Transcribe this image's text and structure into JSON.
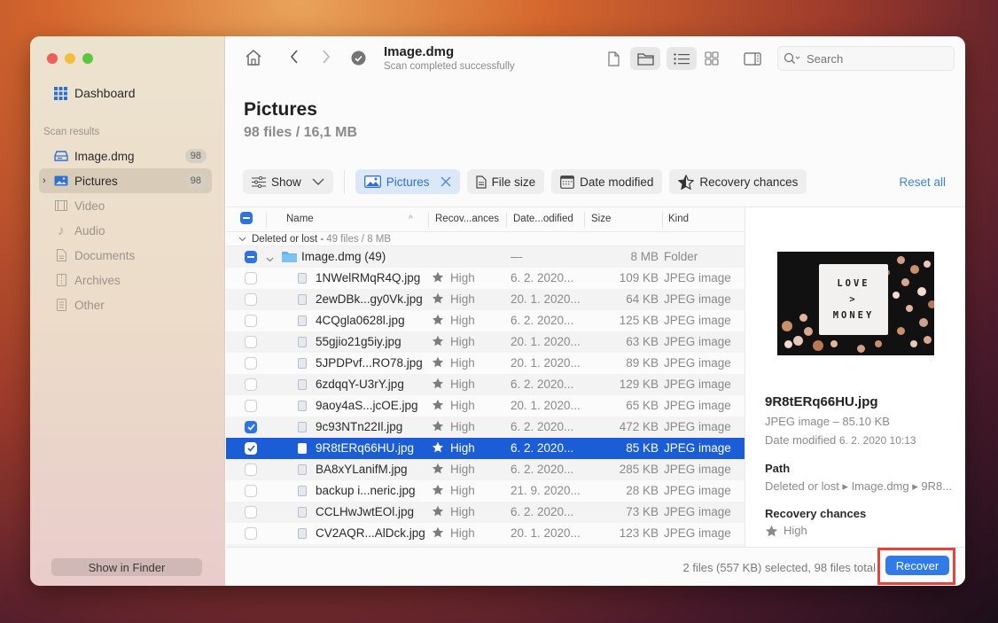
{
  "window": {
    "title": "Image.dmg",
    "subtitle": "Scan completed successfully"
  },
  "sidebar": {
    "dashboard_label": "Dashboard",
    "section_label": "Scan results",
    "items": [
      {
        "label": "Image.dmg",
        "count": "98",
        "icon": "disk-icon",
        "state": "normal"
      },
      {
        "label": "Pictures",
        "count": "98",
        "icon": "picture-icon",
        "state": "active"
      },
      {
        "label": "Video",
        "icon": "film-icon",
        "state": "dim"
      },
      {
        "label": "Audio",
        "icon": "music-note-icon",
        "state": "dim"
      },
      {
        "label": "Documents",
        "icon": "document-icon",
        "state": "dim"
      },
      {
        "label": "Archives",
        "icon": "archive-icon",
        "state": "dim"
      },
      {
        "label": "Other",
        "icon": "other-file-icon",
        "state": "dim"
      }
    ],
    "show_in_finder": "Show in Finder"
  },
  "toolbar": {
    "search_placeholder": "Search"
  },
  "heading": {
    "title": "Pictures",
    "summary": "98 files / 16,1 MB"
  },
  "filters": {
    "show": "Show",
    "pictures": "Pictures",
    "file_size": "File size",
    "date_modified": "Date modified",
    "recovery_chances": "Recovery chances",
    "reset_all": "Reset all"
  },
  "table": {
    "columns": {
      "name": "Name",
      "recovery": "Recov...ances",
      "date": "Date...odified",
      "size": "Size",
      "kind": "Kind"
    },
    "group": {
      "label": "Deleted or lost -",
      "detail": "49 files / 8 MB"
    },
    "folder": {
      "name": "Image.dmg (49)",
      "recovery": "—",
      "size": "8 MB",
      "kind": "Folder"
    },
    "rows": [
      {
        "name": "1NWelRMqR4Q.jpg",
        "chance": "High",
        "date": "6. 2. 2020...",
        "size": "109 KB",
        "kind": "JPEG image",
        "checked": false,
        "selected": false
      },
      {
        "name": "2ewDBk...gy0Vk.jpg",
        "chance": "High",
        "date": "20. 1. 2020...",
        "size": "64 KB",
        "kind": "JPEG image",
        "checked": false,
        "selected": false
      },
      {
        "name": "4CQgla0628l.jpg",
        "chance": "High",
        "date": "6. 2. 2020...",
        "size": "125 KB",
        "kind": "JPEG image",
        "checked": false,
        "selected": false
      },
      {
        "name": "55gjio21g5iy.jpg",
        "chance": "High",
        "date": "20. 1. 2020...",
        "size": "63 KB",
        "kind": "JPEG image",
        "checked": false,
        "selected": false
      },
      {
        "name": "5JPDPvf...RO78.jpg",
        "chance": "High",
        "date": "20. 1. 2020...",
        "size": "89 KB",
        "kind": "JPEG image",
        "checked": false,
        "selected": false
      },
      {
        "name": "6zdqqY-U3rY.jpg",
        "chance": "High",
        "date": "6. 2. 2020...",
        "size": "129 KB",
        "kind": "JPEG image",
        "checked": false,
        "selected": false
      },
      {
        "name": "9aoy4aS...jcOE.jpg",
        "chance": "High",
        "date": "20. 1. 2020...",
        "size": "65 KB",
        "kind": "JPEG image",
        "checked": false,
        "selected": false
      },
      {
        "name": "9c93NTn22Il.jpg",
        "chance": "High",
        "date": "6. 2. 2020...",
        "size": "472 KB",
        "kind": "JPEG image",
        "checked": true,
        "selected": false
      },
      {
        "name": "9R8tERq66HU.jpg",
        "chance": "High",
        "date": "6. 2. 2020...",
        "size": "85 KB",
        "kind": "JPEG image",
        "checked": true,
        "selected": true
      },
      {
        "name": "BA8xYLanifM.jpg",
        "chance": "High",
        "date": "6. 2. 2020...",
        "size": "285 KB",
        "kind": "JPEG image",
        "checked": false,
        "selected": false
      },
      {
        "name": "backup i...neric.jpg",
        "chance": "High",
        "date": "21. 9. 2020...",
        "size": "28 KB",
        "kind": "JPEG image",
        "checked": false,
        "selected": false
      },
      {
        "name": "CCLHwJwtEOl.jpg",
        "chance": "High",
        "date": "6. 2. 2020...",
        "size": "73 KB",
        "kind": "JPEG image",
        "checked": false,
        "selected": false
      },
      {
        "name": "CV2AQR...AlDck.jpg",
        "chance": "High",
        "date": "20. 1. 2020...",
        "size": "123 KB",
        "kind": "JPEG image",
        "checked": false,
        "selected": false
      }
    ]
  },
  "preview": {
    "image_text_line1": "LOVE",
    "image_text_line2": ">",
    "image_text_line3": "MONEY",
    "file_name": "9R8tERq66HU.jpg",
    "type_size": "JPEG image – 85.10 KB",
    "date_label": "Date modified",
    "date_value": "6. 2. 2020 10:13",
    "path_label": "Path",
    "path_value": "Deleted or lost ▸ Image.dmg ▸ 9R8...",
    "recovery_label": "Recovery chances",
    "recovery_value": "High"
  },
  "footer": {
    "status": "2 files (557 KB) selected, 98 files total",
    "recover_label": "Recover"
  },
  "colors": {
    "accent": "#2f7bea",
    "selection": "#1a5dd6",
    "highlight_outline": "#e0463b"
  }
}
